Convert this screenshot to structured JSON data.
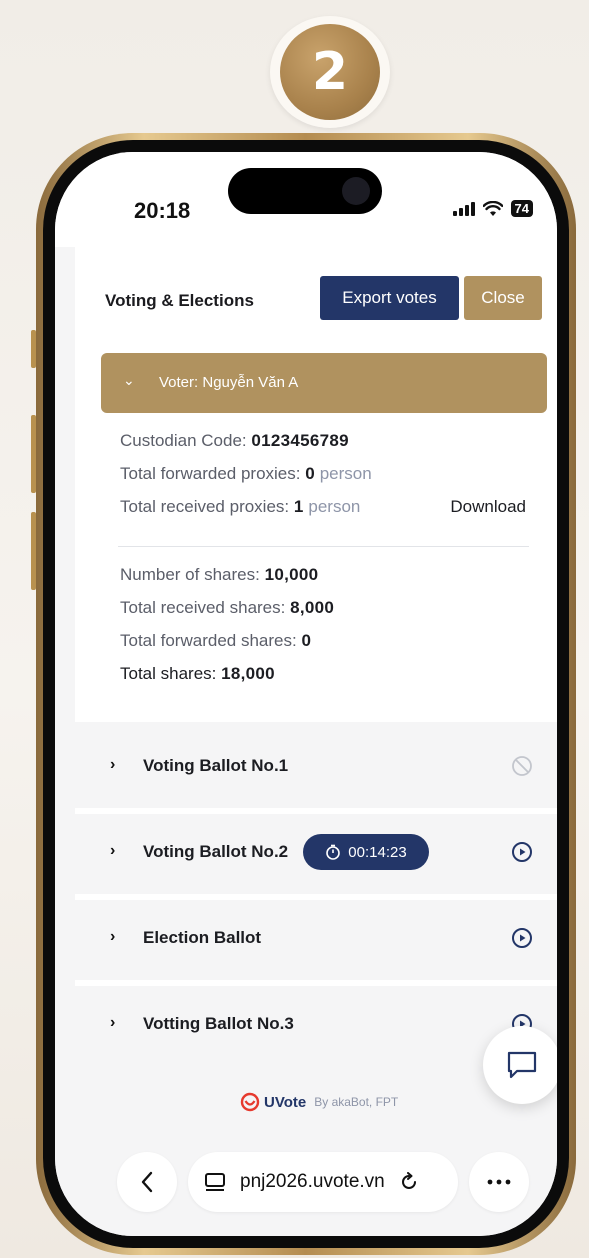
{
  "step_badge": {
    "number": "2"
  },
  "status_bar": {
    "time": "20:18",
    "battery": "74"
  },
  "header": {
    "title": "Voting & Elections",
    "export_label": "Export votes",
    "close_label": "Close"
  },
  "voter": {
    "header_label": "Voter: Nguyễn Văn A",
    "custodian_code_label": "Custodian Code:",
    "custodian_code_value": "0123456789",
    "forwarded_proxies_label": "Total forwarded proxies:",
    "forwarded_proxies_value": "0",
    "received_proxies_label": "Total received proxies:",
    "received_proxies_value": "1",
    "proxy_unit": "person",
    "download_label": "Download",
    "shares_label": "Number of shares:",
    "shares_value": "10,000",
    "received_shares_label": "Total received shares:",
    "received_shares_value": "8,000",
    "forwarded_shares_label": "Total forwarded shares:",
    "forwarded_shares_value": "0",
    "total_shares_label": "Total shares:",
    "total_shares_value": "18,000"
  },
  "ballots": [
    {
      "name": "Voting Ballot No.1",
      "status_icon": "disabled-icon"
    },
    {
      "name": "Voting Ballot No.2",
      "status_icon": "play-circle-icon",
      "timer": "00:14:23"
    },
    {
      "name": "Election Ballot",
      "status_icon": "play-circle-icon"
    },
    {
      "name": "Votting Ballot No.3",
      "status_icon": "play-circle-icon"
    }
  ],
  "footer": {
    "brand": "UVote",
    "by": "By akaBot, FPT"
  },
  "browser": {
    "url": "pnj2026.uvote.vn"
  },
  "colors": {
    "navy": "#233668",
    "gold": "#b0925f",
    "brand_red": "#e63a2e"
  }
}
